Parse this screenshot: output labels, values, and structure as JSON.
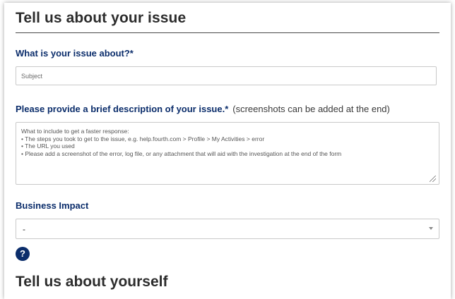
{
  "section": {
    "title": "Tell us about your issue"
  },
  "subject": {
    "label": "What is your issue about?",
    "required_mark": "*",
    "placeholder": "Subject"
  },
  "description": {
    "label": "Please provide a brief description of your issue.",
    "required_mark": "*",
    "note": "(screenshots can be added at the end)",
    "placeholder": "What to include to get a faster response:\n• The steps you took to get to the issue, e.g. help.fourth.com > Profile > My Activities > error\n• The URL you used\n• Please add a screenshot of the error, log file, or any attachment that will aid with the investigation at the end of the form"
  },
  "business_impact": {
    "label": "Business Impact",
    "selected": "-"
  },
  "help": {
    "glyph": "?"
  },
  "next_section": {
    "title": "Tell us about yourself"
  },
  "colors": {
    "label": "#0b2d6b",
    "heading": "#2c2c2c",
    "help_button": "#0b2d6b"
  }
}
